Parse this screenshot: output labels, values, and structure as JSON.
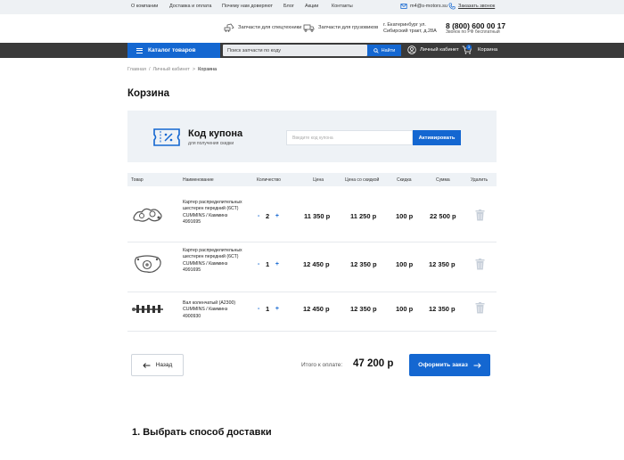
{
  "topnav": {
    "items": [
      "О компании",
      "Доставка и оплата",
      "Почему нам доверяют",
      "Блог",
      "Акции",
      "Контакты"
    ],
    "email": "m4@s-motors.su",
    "callback": "Заказать звонок"
  },
  "header": {
    "link_special": "Запчасти для спецтехники",
    "link_trucks": "Запчасти для грузовиков",
    "address_line1": "г. Екатеринбург ул.",
    "address_line2": "Сибирский тракт, д.28А",
    "phone": "8 (800) 600 00 17",
    "phone_note": "Звонок по РФ бесплатный"
  },
  "navbar": {
    "catalog_label": "Каталог товаров",
    "search_placeholder": "Поиск запчасти по коду",
    "search_button": "Найти",
    "account_label": "Личный кабинет",
    "cart_label": "Корзина",
    "cart_count": "3"
  },
  "breadcrumb": [
    "Главная",
    "Личный кабинет",
    "Корзина"
  ],
  "page": {
    "title": "Корзина"
  },
  "coupon": {
    "title": "Код купона",
    "subtitle": "для получения скидки",
    "placeholder": "Введите код купона",
    "button": "Активировать"
  },
  "table": {
    "headers": {
      "product": "Товар",
      "name": "Наименование",
      "qty": "Количество",
      "price": "Цена",
      "discount_price": "Цена со скидкой",
      "discount": "Скидка",
      "sum": "Сумма",
      "delete": "Удалить"
    },
    "rows": [
      {
        "name": "Картер распределительных шестерен передний (6СТ) CUMMINS / Камминз 4991695",
        "qty": "2",
        "price": "11 350 р",
        "discount_price": "11 250 р",
        "discount": "100 р",
        "sum": "22 500 р"
      },
      {
        "name": "Картер распределительных шестерен передний (6СТ) CUMMINS / Камминз 4991695",
        "qty": "1",
        "price": "12 450 р",
        "discount_price": "12 350 р",
        "discount": "100 р",
        "sum": "12 350 р"
      },
      {
        "name": "Вал коленчатый (А2300) CUMMINS / Камминз 4900930",
        "qty": "1",
        "price": "12 450 р",
        "discount_price": "12 350 р",
        "discount": "100 р",
        "sum": "12 350 р"
      }
    ]
  },
  "footer": {
    "back_label": "Назад",
    "total_label": "Итого к оплате:",
    "total_value": "47 200 р",
    "order_label": "Оформить заказ"
  },
  "delivery": {
    "title": "1. Выбрать способ доставки"
  },
  "colors": {
    "accent": "#1467d1",
    "navbar": "#3a3a3a",
    "panel": "#eef2f6"
  }
}
